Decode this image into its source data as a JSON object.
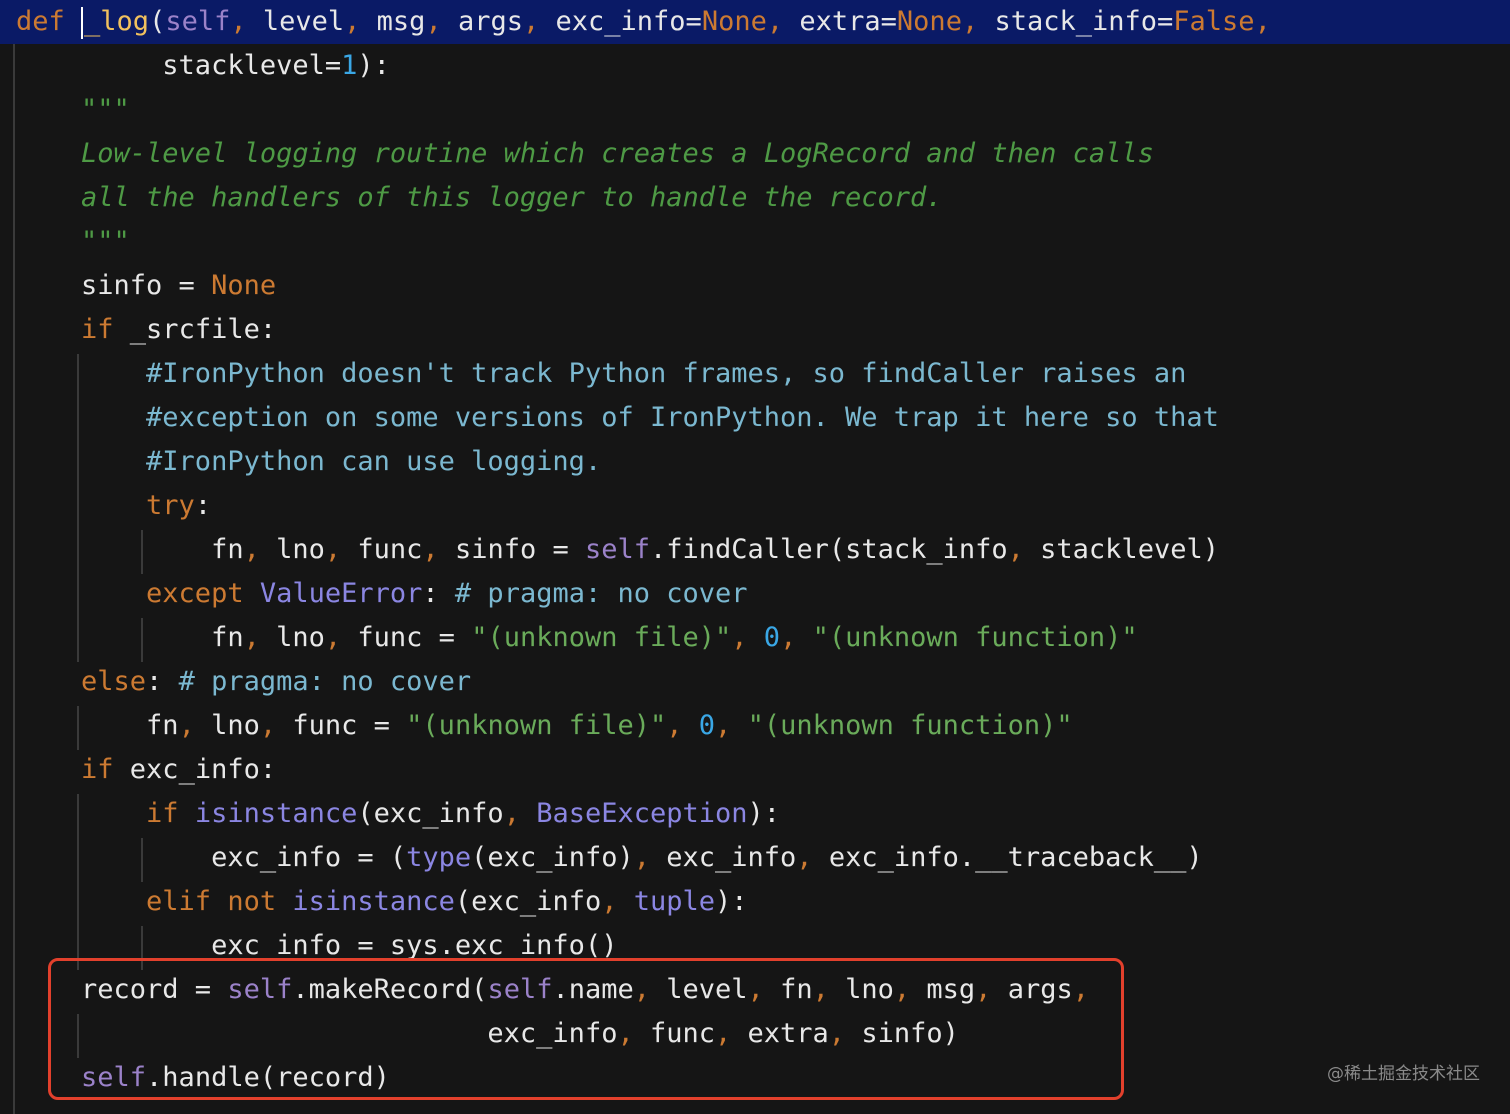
{
  "code_lines": [
    [
      {
        "c": "kw",
        "t": "def "
      },
      {
        "c": "caret",
        "t": ""
      },
      {
        "c": "fnname",
        "t": "_log"
      },
      {
        "c": "plain",
        "t": "("
      },
      {
        "c": "self",
        "t": "self"
      },
      {
        "c": "punc",
        "t": ", "
      },
      {
        "c": "plain",
        "t": "level"
      },
      {
        "c": "punc",
        "t": ", "
      },
      {
        "c": "plain",
        "t": "msg"
      },
      {
        "c": "punc",
        "t": ", "
      },
      {
        "c": "plain",
        "t": "args"
      },
      {
        "c": "punc",
        "t": ", "
      },
      {
        "c": "plain",
        "t": "exc_info="
      },
      {
        "c": "kw",
        "t": "None"
      },
      {
        "c": "punc",
        "t": ", "
      },
      {
        "c": "plain",
        "t": "extra="
      },
      {
        "c": "kw",
        "t": "None"
      },
      {
        "c": "punc",
        "t": ", "
      },
      {
        "c": "plain",
        "t": "stack_info="
      },
      {
        "c": "kw",
        "t": "False"
      },
      {
        "c": "punc",
        "t": ","
      }
    ],
    [
      {
        "c": "plain",
        "t": "         stacklevel="
      },
      {
        "c": "num",
        "t": "1"
      },
      {
        "c": "plain",
        "t": "):"
      }
    ],
    [
      {
        "c": "doc",
        "t": "    \"\"\""
      }
    ],
    [
      {
        "c": "doc",
        "t": "    Low-level logging routine which creates a LogRecord and then calls"
      }
    ],
    [
      {
        "c": "doc",
        "t": "    all the handlers of this logger to handle the record."
      }
    ],
    [
      {
        "c": "doc",
        "t": "    \"\"\""
      }
    ],
    [
      {
        "c": "plain",
        "t": "    sinfo = "
      },
      {
        "c": "kw",
        "t": "None"
      }
    ],
    [
      {
        "c": "kw",
        "t": "    if "
      },
      {
        "c": "plain",
        "t": "_srcfile:"
      }
    ],
    [
      {
        "c": "cmt",
        "t": "        #IronPython doesn't track Python frames, so findCaller raises an"
      }
    ],
    [
      {
        "c": "cmt",
        "t": "        #exception on some versions of IronPython. We trap it here so that"
      }
    ],
    [
      {
        "c": "cmt",
        "t": "        #IronPython can use logging."
      }
    ],
    [
      {
        "c": "kw",
        "t": "        try"
      },
      {
        "c": "plain",
        "t": ":"
      }
    ],
    [
      {
        "c": "plain",
        "t": "            fn"
      },
      {
        "c": "punc",
        "t": ", "
      },
      {
        "c": "plain",
        "t": "lno"
      },
      {
        "c": "punc",
        "t": ", "
      },
      {
        "c": "plain",
        "t": "func"
      },
      {
        "c": "punc",
        "t": ", "
      },
      {
        "c": "plain",
        "t": "sinfo = "
      },
      {
        "c": "self",
        "t": "self"
      },
      {
        "c": "plain",
        "t": ".findCaller(stack_info"
      },
      {
        "c": "punc",
        "t": ", "
      },
      {
        "c": "plain",
        "t": "stacklevel)"
      }
    ],
    [
      {
        "c": "kw",
        "t": "        except "
      },
      {
        "c": "builtin",
        "t": "ValueError"
      },
      {
        "c": "plain",
        "t": ": "
      },
      {
        "c": "cmt",
        "t": "# pragma: no cover"
      }
    ],
    [
      {
        "c": "plain",
        "t": "            fn"
      },
      {
        "c": "punc",
        "t": ", "
      },
      {
        "c": "plain",
        "t": "lno"
      },
      {
        "c": "punc",
        "t": ", "
      },
      {
        "c": "plain",
        "t": "func = "
      },
      {
        "c": "str",
        "t": "\"(unknown file)\""
      },
      {
        "c": "punc",
        "t": ", "
      },
      {
        "c": "num",
        "t": "0"
      },
      {
        "c": "punc",
        "t": ", "
      },
      {
        "c": "str",
        "t": "\"(unknown function)\""
      }
    ],
    [
      {
        "c": "kw",
        "t": "    else"
      },
      {
        "c": "plain",
        "t": ": "
      },
      {
        "c": "cmt",
        "t": "# pragma: no cover"
      }
    ],
    [
      {
        "c": "plain",
        "t": "        fn"
      },
      {
        "c": "punc",
        "t": ", "
      },
      {
        "c": "plain",
        "t": "lno"
      },
      {
        "c": "punc",
        "t": ", "
      },
      {
        "c": "plain",
        "t": "func = "
      },
      {
        "c": "str",
        "t": "\"(unknown file)\""
      },
      {
        "c": "punc",
        "t": ", "
      },
      {
        "c": "num",
        "t": "0"
      },
      {
        "c": "punc",
        "t": ", "
      },
      {
        "c": "str",
        "t": "\"(unknown function)\""
      }
    ],
    [
      {
        "c": "kw",
        "t": "    if "
      },
      {
        "c": "plain",
        "t": "exc_info:"
      }
    ],
    [
      {
        "c": "kw",
        "t": "        if "
      },
      {
        "c": "builtin",
        "t": "isinstance"
      },
      {
        "c": "plain",
        "t": "(exc_info"
      },
      {
        "c": "punc",
        "t": ", "
      },
      {
        "c": "builtin",
        "t": "BaseException"
      },
      {
        "c": "plain",
        "t": "):"
      }
    ],
    [
      {
        "c": "plain",
        "t": "            exc_info = ("
      },
      {
        "c": "builtin",
        "t": "type"
      },
      {
        "c": "plain",
        "t": "(exc_info)"
      },
      {
        "c": "punc",
        "t": ", "
      },
      {
        "c": "plain",
        "t": "exc_info"
      },
      {
        "c": "punc",
        "t": ", "
      },
      {
        "c": "plain",
        "t": "exc_info.__traceback__)"
      }
    ],
    [
      {
        "c": "kw",
        "t": "        elif not "
      },
      {
        "c": "builtin",
        "t": "isinstance"
      },
      {
        "c": "plain",
        "t": "(exc_info"
      },
      {
        "c": "punc",
        "t": ", "
      },
      {
        "c": "builtin",
        "t": "tuple"
      },
      {
        "c": "plain",
        "t": "):"
      }
    ],
    [
      {
        "c": "plain",
        "t": "            exc_info = sys.exc_info()"
      }
    ],
    [
      {
        "c": "plain",
        "t": "    record = "
      },
      {
        "c": "self",
        "t": "self"
      },
      {
        "c": "plain",
        "t": ".makeRecord("
      },
      {
        "c": "self",
        "t": "self"
      },
      {
        "c": "plain",
        "t": ".name"
      },
      {
        "c": "punc",
        "t": ", "
      },
      {
        "c": "plain",
        "t": "level"
      },
      {
        "c": "punc",
        "t": ", "
      },
      {
        "c": "plain",
        "t": "fn"
      },
      {
        "c": "punc",
        "t": ", "
      },
      {
        "c": "plain",
        "t": "lno"
      },
      {
        "c": "punc",
        "t": ", "
      },
      {
        "c": "plain",
        "t": "msg"
      },
      {
        "c": "punc",
        "t": ", "
      },
      {
        "c": "plain",
        "t": "args"
      },
      {
        "c": "punc",
        "t": ","
      }
    ],
    [
      {
        "c": "plain",
        "t": "                             exc_info"
      },
      {
        "c": "punc",
        "t": ", "
      },
      {
        "c": "plain",
        "t": "func"
      },
      {
        "c": "punc",
        "t": ", "
      },
      {
        "c": "plain",
        "t": "extra"
      },
      {
        "c": "punc",
        "t": ", "
      },
      {
        "c": "plain",
        "t": "sinfo)"
      }
    ],
    [
      {
        "c": "self",
        "t": "    self"
      },
      {
        "c": "plain",
        "t": ".handle(record)"
      }
    ]
  ],
  "watermark": "@稀土掘金技术社区",
  "colors": {
    "background": "#151515",
    "keyword": "#cc7a32",
    "self": "#9b82c9",
    "number": "#3aa7e5",
    "string": "#6aab5a",
    "docstring": "#4e9a45",
    "comment": "#7bb8d0",
    "builtin": "#8b86e2",
    "function_name": "#f1c15e",
    "highlight_box": "#e2402c",
    "first_line_bg": "#0a1a66"
  }
}
